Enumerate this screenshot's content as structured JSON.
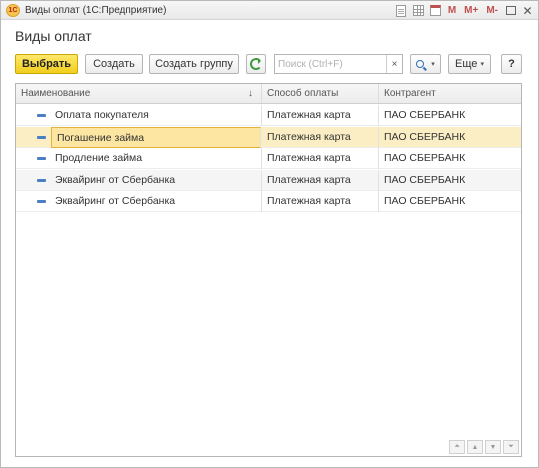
{
  "window": {
    "title": "Виды оплат  (1С:Предприятие)",
    "logo_text": "1С",
    "controls": {
      "m": "M",
      "m_plus": "M+",
      "m_minus": "M-"
    }
  },
  "page": {
    "title": "Виды оплат"
  },
  "toolbar": {
    "select_label": "Выбрать",
    "create_label": "Создать",
    "create_group_label": "Создать группу",
    "search_placeholder": "Поиск (Ctrl+F)",
    "search_value": "",
    "more_label": "Еще",
    "help_label": "?"
  },
  "table": {
    "columns": [
      "Наименование",
      "Способ оплаты",
      "Контрагент"
    ],
    "sort_indicator": "↓",
    "rows": [
      {
        "name": "Оплата покупателя",
        "method": "Платежная карта",
        "counterparty": "ПАО СБЕРБАНК",
        "selected": false
      },
      {
        "name": "Погашение займа",
        "method": "Платежная карта",
        "counterparty": "ПАО СБЕРБАНК",
        "selected": true
      },
      {
        "name": "Продление займа",
        "method": "Платежная карта",
        "counterparty": "ПАО СБЕРБАНК",
        "selected": false
      },
      {
        "name": "Эквайринг от Сбербанка",
        "method": "Платежная карта",
        "counterparty": "ПАО СБЕРБАНК",
        "selected": false
      },
      {
        "name": "Эквайринг от Сбербанка",
        "method": "Платежная карта",
        "counterparty": "ПАО СБЕРБАНК",
        "selected": false
      }
    ]
  },
  "colors": {
    "primary_button": "#f2cd1d",
    "selected_row": "#fbeec4",
    "item_icon": "#4a7fc1"
  }
}
